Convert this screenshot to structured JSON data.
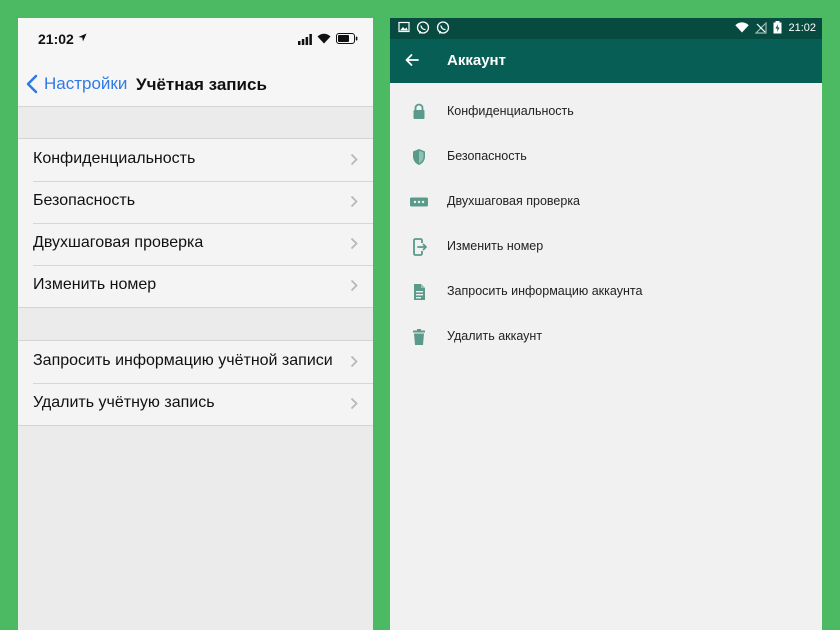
{
  "ios": {
    "status_time": "21:02",
    "back_label": "Настройки",
    "title": "Учётная запись",
    "accent_color": "#2f7ae5",
    "groups": [
      [
        "Конфиденциальность",
        "Безопасность",
        "Двухшаговая проверка",
        "Изменить номер"
      ],
      [
        "Запросить информацию учётной записи",
        "Удалить учётную запись"
      ]
    ]
  },
  "android": {
    "status_time": "21:02",
    "title": "Аккаунт",
    "appbar_color": "#075e54",
    "icon_color": "#5a9a8a",
    "items": [
      {
        "label": "Конфиденциальность",
        "icon": "lock-icon"
      },
      {
        "label": "Безопасность",
        "icon": "shield-icon"
      },
      {
        "label": "Двухшаговая проверка",
        "icon": "pin-dots-icon"
      },
      {
        "label": "Изменить номер",
        "icon": "phone-change-icon"
      },
      {
        "label": "Запросить информацию аккаунта",
        "icon": "document-icon"
      },
      {
        "label": "Удалить аккаунт",
        "icon": "trash-icon"
      }
    ]
  }
}
